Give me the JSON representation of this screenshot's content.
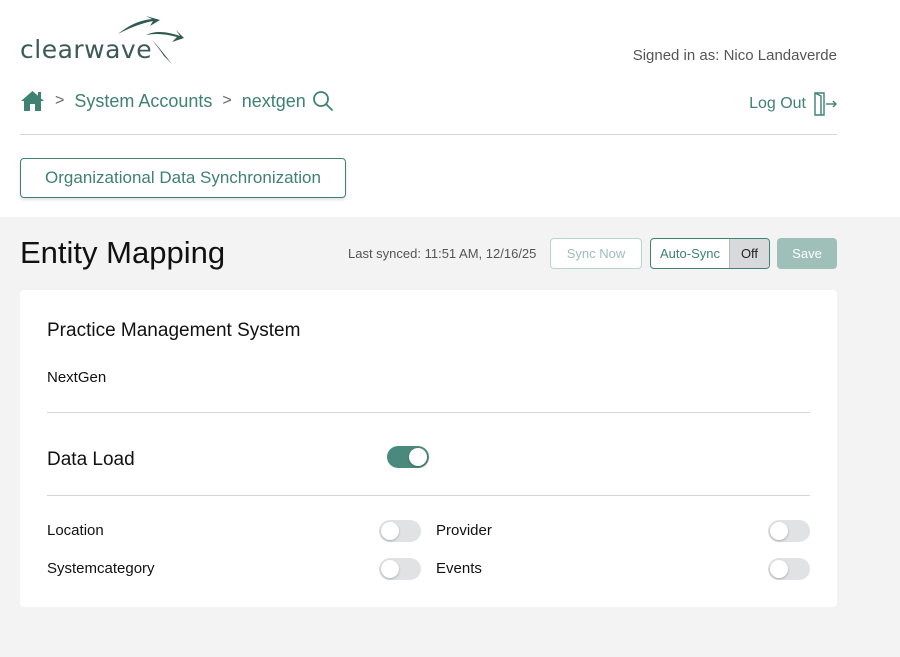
{
  "brand": {
    "name": "clearwave",
    "color": "#3f8173"
  },
  "header": {
    "signed_in": "Signed in as: Nico Landaverde",
    "logout_label": "Log Out"
  },
  "breadcrumb": {
    "sep1": ">",
    "item1": "System Accounts",
    "sep2": ">",
    "item2": "nextgen"
  },
  "org_button_label": "Organizational Data Synchronization",
  "page": {
    "title": "Entity Mapping",
    "last_synced": "Last synced: 11:51 AM, 12/16/25",
    "sync_now_label": "Sync Now",
    "auto_sync_label": "Auto-Sync",
    "auto_sync_state": "Off",
    "save_label": "Save"
  },
  "card": {
    "pms_title": "Practice Management System",
    "pms_value": "NextGen",
    "data_load_label": "Data Load",
    "data_load_on": true,
    "entities": [
      {
        "label": "Location",
        "on": false
      },
      {
        "label": "Provider",
        "on": false
      },
      {
        "label": "Systemcategory",
        "on": false
      },
      {
        "label": "Events",
        "on": false
      }
    ]
  },
  "icons": [
    "home-icon",
    "search-icon",
    "logout-door-icon",
    "clearwave-logo-mark"
  ]
}
